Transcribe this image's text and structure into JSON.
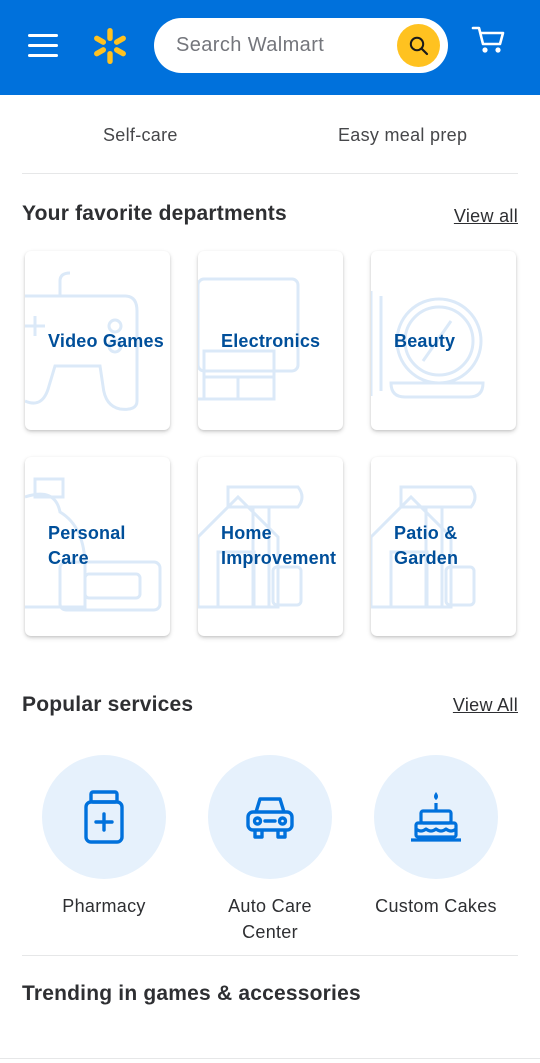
{
  "header": {
    "search": {
      "placeholder": "Search Walmart"
    },
    "icons": {
      "menu": "hamburger-menu-icon",
      "logo": "walmart-spark-icon",
      "search": "search-icon",
      "cart": "cart-icon"
    },
    "colors": {
      "brand_blue": "#0071dc",
      "spark_yellow": "#ffc220"
    }
  },
  "chips": [
    "Self-care",
    "Easy meal prep"
  ],
  "departments": {
    "title": "Your favorite departments",
    "view_all": "View all",
    "items": [
      {
        "label": "Video Games",
        "icon": "game-controller-icon"
      },
      {
        "label": "Electronics",
        "icon": "computer-monitor-icon"
      },
      {
        "label": "Beauty",
        "icon": "mirror-icon"
      },
      {
        "label": "Personal\nCare",
        "icon": "soap-bottle-icon"
      },
      {
        "label": "Home\nImprovement",
        "icon": "hammer-house-icon"
      },
      {
        "label": "Patio &\nGarden",
        "icon": "hammer-house-icon"
      }
    ],
    "label_color": "#004f9a"
  },
  "services": {
    "title": "Popular services",
    "view_all": "View All",
    "items": [
      {
        "label": "Pharmacy",
        "icon": "pill-bottle-icon"
      },
      {
        "label": "Auto Care\nCenter",
        "icon": "car-icon"
      },
      {
        "label": "Custom Cakes",
        "icon": "birthday-cake-icon"
      }
    ],
    "circle_color": "#e6f1fc"
  },
  "trending": {
    "title": "Trending in games & accessories"
  }
}
